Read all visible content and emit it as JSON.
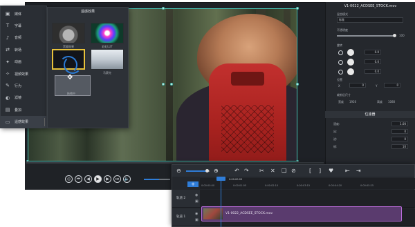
{
  "left_nav": {
    "items": [
      {
        "icon": "media-icon",
        "glyph": "▣",
        "label": "媒体"
      },
      {
        "icon": "text-icon",
        "glyph": "T",
        "label": "字幕"
      },
      {
        "icon": "mic-icon",
        "glyph": "♪",
        "label": "音频"
      },
      {
        "icon": "transition-icon",
        "glyph": "⇄",
        "label": "转场"
      },
      {
        "icon": "magic-wand-icon",
        "glyph": "✦",
        "label": "动画"
      },
      {
        "icon": "effects-icon",
        "glyph": "✧",
        "label": "视频效果"
      },
      {
        "icon": "pen-icon",
        "glyph": "✎",
        "label": "行为"
      },
      {
        "icon": "filter-icon",
        "glyph": "◐",
        "label": "滤镜"
      },
      {
        "icon": "overlay-icon",
        "glyph": "▤",
        "label": "叠加"
      },
      {
        "icon": "transition-effect-icon",
        "glyph": "▭",
        "label": "遥感效果"
      }
    ]
  },
  "transitions_panel": {
    "title": "遥感效果",
    "thumb_labels": [
      "黑猫效果",
      "彩虹LUT",
      "",
      "马赛克",
      "拖拽中"
    ]
  },
  "properties_panel": {
    "title": "V1-0022_ACDSEE_STOCK.mov",
    "blend_label": "混合模式",
    "blend_value": "标准",
    "opacity_label": "不透明度",
    "opacity_value": "100",
    "rotation_label": "旋转",
    "rotation_values": [
      "0.0",
      "0.0",
      "0.0"
    ],
    "position_label": "位置",
    "position_x": "0",
    "position_y": "0",
    "size_label": "裁剪后尺寸",
    "width_label": "宽度",
    "width_value": "1920",
    "height_label": "高度",
    "height_value": "1080",
    "section2_title": "位速器",
    "speed_rows": [
      {
        "label": "速度:",
        "value": "1.00"
      },
      {
        "label": "出:",
        "value": "0"
      },
      {
        "label": "进:",
        "value": "0"
      },
      {
        "label": "帧:",
        "value": "10"
      }
    ]
  },
  "player": {
    "controls": [
      "snapshot-icon",
      "prev-frame-icon",
      "rewind-icon",
      "play-icon",
      "forward-icon",
      "next-frame-icon",
      "volume-icon"
    ],
    "control_glyphs": [
      "◎",
      "⏮",
      "◀",
      "▶",
      "▶",
      "⏭",
      "🔈"
    ],
    "volume_level": 0.58
  },
  "timeline": {
    "toolbar_glyphs": [
      "⊖",
      "⊕",
      "↶",
      "↷",
      "✂",
      "✕",
      "❑",
      "⊘",
      "[",
      "]",
      "♥",
      "⇤",
      "⇥"
    ],
    "toolbar_icons": [
      "zoom-out-icon",
      "zoom-in-icon",
      "undo-icon",
      "redo-icon",
      "split-icon",
      "delete-icon",
      "copy-icon",
      "disable-icon",
      "mark-in-icon",
      "mark-out-icon",
      "marker-icon",
      "go-start-icon",
      "go-end-icon"
    ],
    "add_label": "+",
    "ruler_ticks": [
      "0:00:00:00",
      "0:00:01:05",
      "0:00:02:10",
      "0:00:03:15",
      "0:00:04:20",
      "0:00:05:25"
    ],
    "playhead_time": "0:00:00:09",
    "tracks": [
      {
        "name": "轨道 2",
        "clip": ""
      },
      {
        "name": "轨道 1",
        "clip": "V1-0022_ACDSEE_STOCK.mov"
      }
    ]
  },
  "colors": {
    "accent": "#2f7dd8",
    "selection": "#49c3b5",
    "clip": "#b86bd8"
  }
}
